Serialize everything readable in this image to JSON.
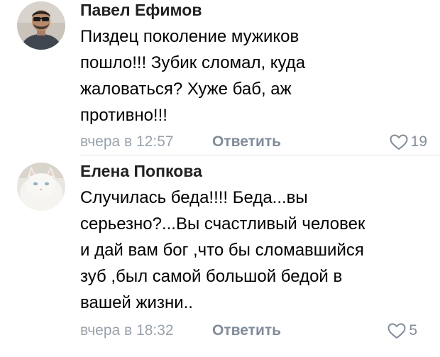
{
  "comments": [
    {
      "author": "Павел Ефимов",
      "text_lines": [
        "Пиздец поколение  мужиков",
        "пошло!!! Зубик сломал, куда",
        "жаловаться? Хуже баб, аж",
        "противно!!!"
      ],
      "time": "вчера в 12:57",
      "reply_label": "Ответить",
      "likes": "19"
    },
    {
      "author": "Елена Попкова",
      "text_lines": [
        "Случилась беда!!!! Беда...вы",
        "серьезно?...Вы счастливый человек",
        "и дай вам бог ,что бы сломавшийся",
        "зуб ,был самой большой бедой в",
        "вашей жизни.."
      ],
      "time": "вчера в 18:32",
      "reply_label": "Ответить",
      "likes": "5"
    }
  ],
  "icons": {
    "like": "heart-outline-icon"
  },
  "colors": {
    "author": "#222222",
    "text": "#000000",
    "meta": "#99a2ad",
    "reply": "#818c99",
    "divider": "#e7e8ec"
  }
}
